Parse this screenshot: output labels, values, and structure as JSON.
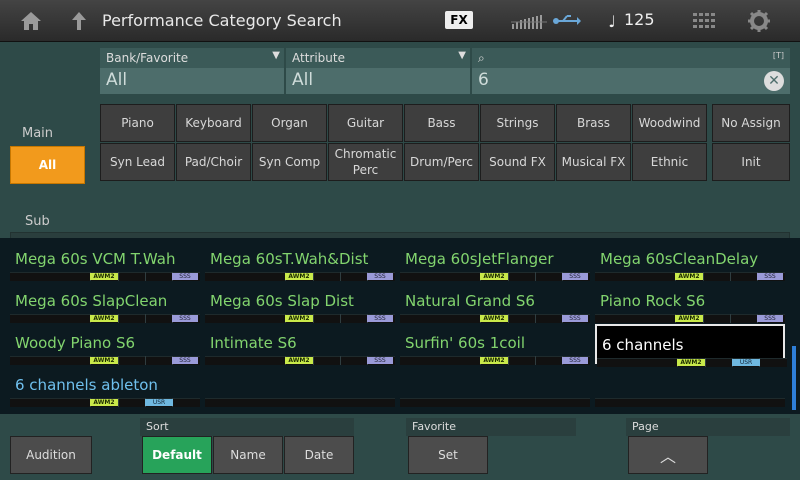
{
  "header": {
    "title": "Performance Category Search",
    "fx": "FX",
    "tempo": "125"
  },
  "filter": {
    "bank_label": "Bank/Favorite",
    "bank_value": "All",
    "attribute_label": "Attribute",
    "attribute_value": "All",
    "search_value": "6",
    "text_badge": "[T]",
    "main_label": "Main",
    "sub_label": "Sub",
    "all_label": "All",
    "main_categories": [
      "Piano",
      "Keyboard",
      "Organ",
      "Guitar",
      "Bass",
      "Strings",
      "Brass",
      "Woodwind",
      "No Assign"
    ],
    "sub_categories": [
      "Syn Lead",
      "Pad/Choir",
      "Syn Comp",
      "Chromatic Perc",
      "Drum/Perc",
      "Sound FX",
      "Musical FX",
      "Ethnic",
      "Init"
    ]
  },
  "results": [
    {
      "name": "Mega 60s VCM T.Wah",
      "badge": "SSS"
    },
    {
      "name": "Mega 60sT.Wah&Dist",
      "badge": "SSS"
    },
    {
      "name": "Mega 60sJetFlanger",
      "badge": "SSS"
    },
    {
      "name": "Mega 60sCleanDelay",
      "badge": "SSS"
    },
    {
      "name": "Mega 60s SlapClean",
      "badge": "SSS"
    },
    {
      "name": "Mega 60s Slap Dist",
      "badge": "SSS"
    },
    {
      "name": "Natural Grand S6",
      "badge": "SSS"
    },
    {
      "name": "Piano Rock S6",
      "badge": "SSS"
    },
    {
      "name": "Woody Piano S6",
      "badge": "SSS"
    },
    {
      "name": "Intimate S6",
      "badge": "SSS"
    },
    {
      "name": "Surfin' 60s 1coil",
      "badge": "SSS"
    },
    {
      "name": "6 channels",
      "badge": "USR"
    },
    {
      "name": "6 channels ableton",
      "badge": "USR"
    }
  ],
  "badge_awm": "AWM2",
  "bottom": {
    "audition": "Audition",
    "sort_label": "Sort",
    "sort_options": [
      "Default",
      "Name",
      "Date"
    ],
    "sort_selected": "Default",
    "favorite_label": "Favorite",
    "favorite_set": "Set",
    "page_label": "Page",
    "page_up": "︿"
  },
  "colors": {
    "accent": "#f29a1c",
    "active_sort": "#27a35a",
    "result_text": "#82d46e",
    "user_text": "#6fc0ee"
  }
}
